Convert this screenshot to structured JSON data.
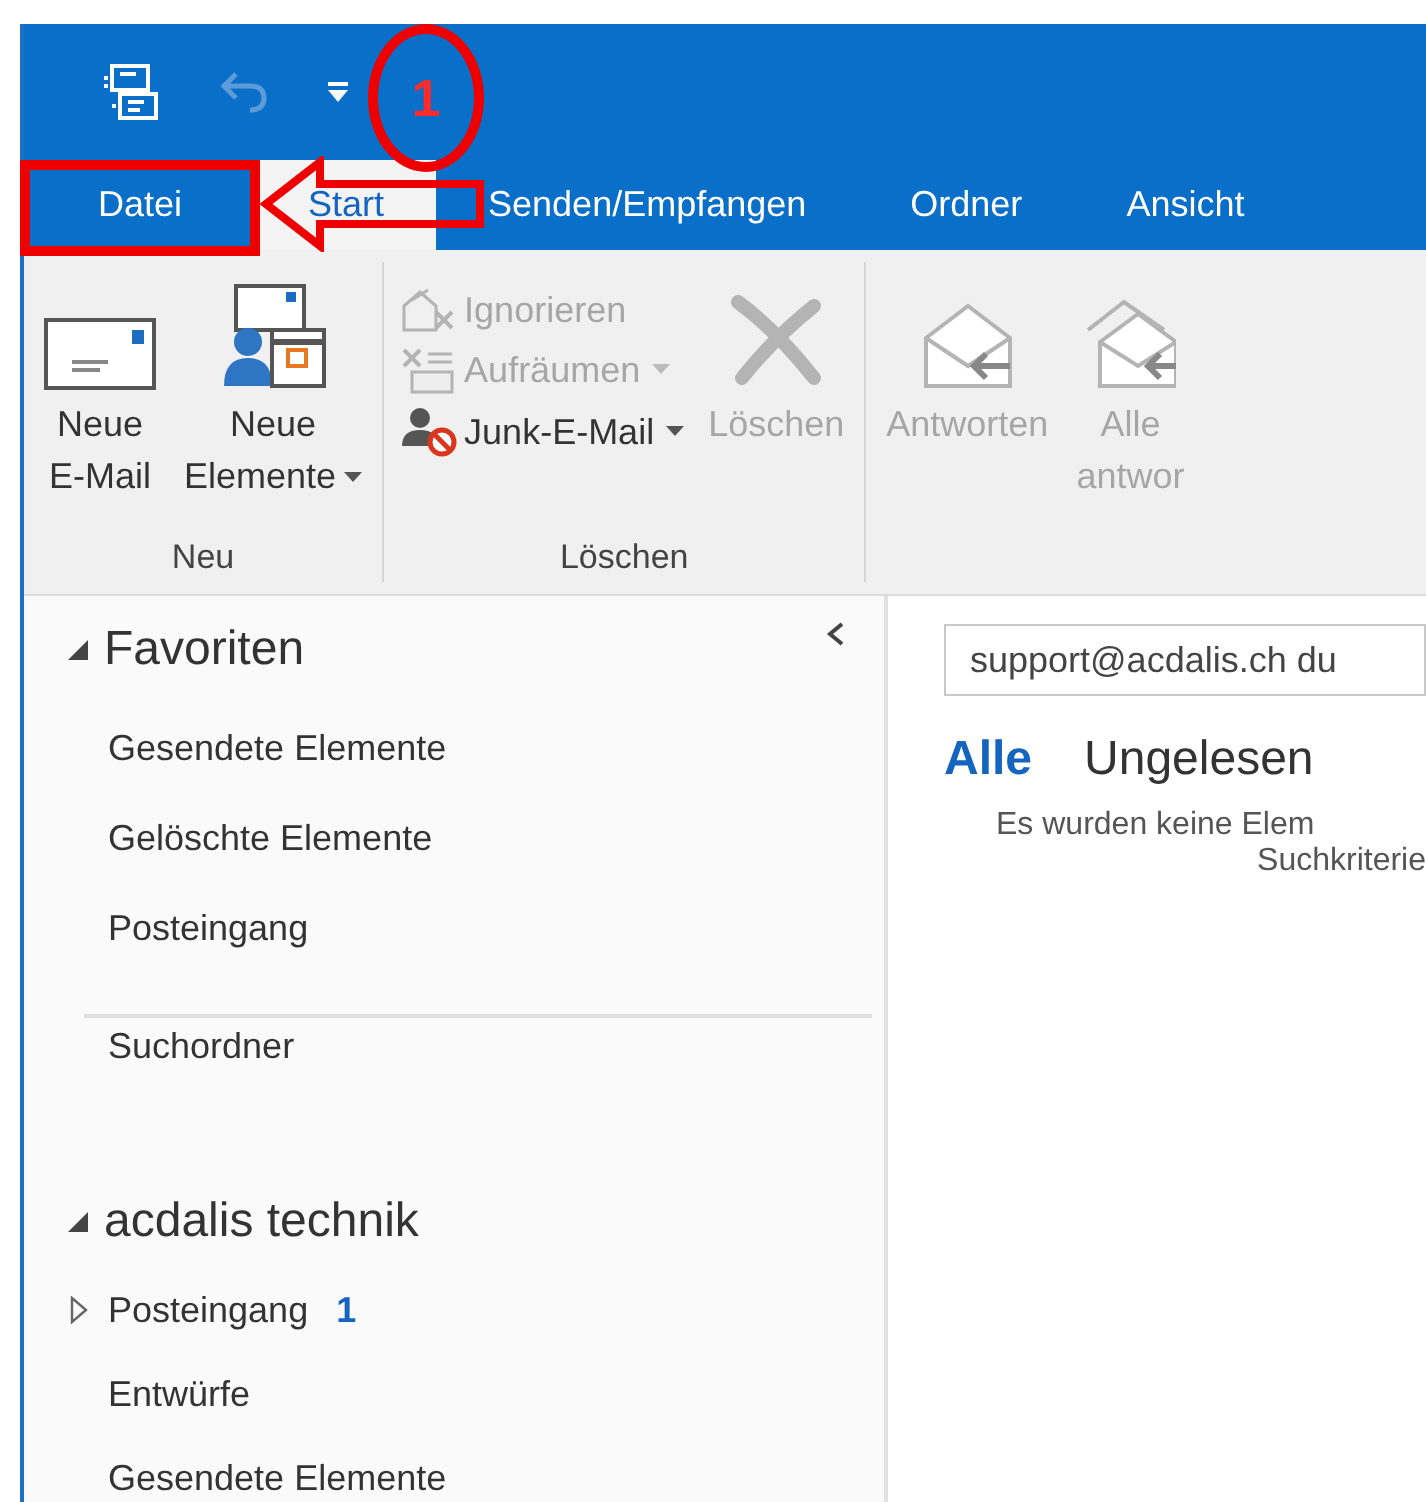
{
  "quick_access": {
    "undo_disabled": true
  },
  "tabs": [
    {
      "label": "Datei",
      "kind": "file",
      "selected": false
    },
    {
      "label": "Start",
      "kind": "tab",
      "selected": true
    },
    {
      "label": "Senden/Empfangen",
      "kind": "tab",
      "selected": false
    },
    {
      "label": "Ordner",
      "kind": "tab",
      "selected": false
    },
    {
      "label": "Ansicht",
      "kind": "tab",
      "selected": false
    }
  ],
  "ribbon": {
    "groups": [
      {
        "label": "Neu",
        "controls": [
          {
            "kind": "large",
            "lines": [
              "Neue",
              "E-Mail"
            ],
            "dropdown": false,
            "disabled": false
          },
          {
            "kind": "large",
            "lines": [
              "Neue",
              "Elemente"
            ],
            "dropdown": true,
            "disabled": false
          }
        ]
      },
      {
        "label": "Löschen",
        "controls": [
          {
            "kind": "stack",
            "items": [
              {
                "label": "Ignorieren",
                "dropdown": false,
                "disabled": true
              },
              {
                "label": "Aufräumen",
                "dropdown": true,
                "disabled": true
              },
              {
                "label": "Junk-E-Mail",
                "dropdown": true,
                "disabled": false
              }
            ]
          },
          {
            "kind": "large",
            "lines": [
              "Löschen"
            ],
            "dropdown": false,
            "disabled": true
          }
        ]
      },
      {
        "controls": [
          {
            "kind": "large",
            "lines": [
              "Antworten"
            ],
            "dropdown": false,
            "disabled": true
          },
          {
            "kind": "large",
            "lines": [
              "Alle",
              "antwor"
            ],
            "dropdown": false,
            "disabled": true
          }
        ]
      }
    ]
  },
  "sidebar": {
    "sections": [
      {
        "title": "Favoriten",
        "expanded": true,
        "items": [
          {
            "label": "Gesendete Elemente",
            "kind": "folder"
          },
          {
            "label": "Gelöschte Elemente",
            "kind": "folder"
          },
          {
            "label": "Posteingang",
            "kind": "folder"
          }
        ]
      },
      {
        "items": [
          {
            "label": "Suchordner",
            "kind": "folder"
          }
        ]
      },
      {
        "title": "acdalis technik",
        "expanded": true,
        "items": [
          {
            "label": "Posteingang",
            "kind": "parent",
            "expanded": false,
            "count": "1"
          },
          {
            "label": "Entwürfe",
            "kind": "folder"
          },
          {
            "label": "Gesendete Elemente",
            "kind": "folder"
          }
        ]
      }
    ]
  },
  "mail_list": {
    "search": {
      "value": "support@acdalis.ch du"
    },
    "filters": [
      {
        "label": "Alle",
        "selected": true
      },
      {
        "label": "Ungelesen",
        "selected": false
      }
    ],
    "empty_message": [
      "Es wurden keine Elem",
      "Suchkriterie"
    ]
  },
  "annotation": {
    "step_label": "1"
  }
}
